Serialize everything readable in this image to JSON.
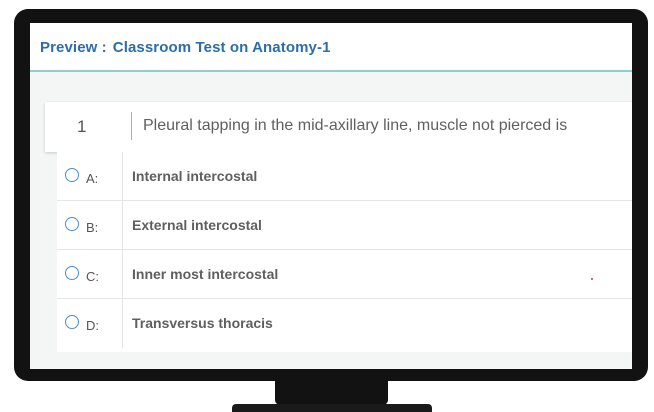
{
  "header": {
    "prefix": "Preview :",
    "test_name": "Classroom Test on Anatomy-1"
  },
  "question": {
    "number": "1",
    "text": "Pleural tapping in the mid-axillary line, muscle not pierced is"
  },
  "options": [
    {
      "letter": "A:",
      "text": "Internal intercostal"
    },
    {
      "letter": "B:",
      "text": "External intercostal"
    },
    {
      "letter": "C:",
      "text": "Inner most intercostal"
    },
    {
      "letter": "D:",
      "text": "Transversus thoracis"
    }
  ],
  "colors": {
    "title_blue": "#2d6ea7",
    "accent_teal": "#79c7c2",
    "radio_blue": "#4a8fc6",
    "monitor_bezel": "#121212"
  }
}
